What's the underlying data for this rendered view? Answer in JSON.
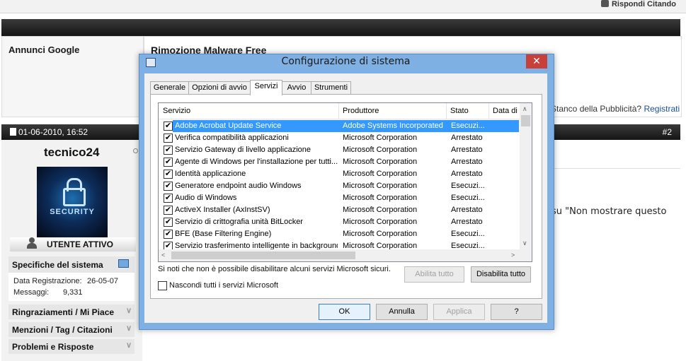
{
  "forum": {
    "reply_quote": "Rispondi Citando",
    "ad_label": "Annunci Google",
    "ad_title": "Rimozione Malware Free",
    "ad_tail_text": "Stanco della Pubblicità?",
    "ad_tail_link": "Registrati",
    "post_date": "01-06-2010, 16:52",
    "post_number": "#2",
    "username": "tecnico24",
    "avatar_text": "SECURITY",
    "user_status": "UTENTE ATTIVO",
    "system_specs": "Specifiche del sistema",
    "reg_label": "Data Registrazione:",
    "reg_value": "26-05-07",
    "msgs_label": "Messaggi:",
    "msgs_value": "9,331",
    "thanks": "Ringraziamenti / Mi Piace",
    "mentions": "Menzioni / Tag / Citazioni",
    "problems": "Problemi e Risposte",
    "post_text": "su \"Non mostrare questo"
  },
  "dialog": {
    "title": "Configurazione di sistema",
    "close": "✕",
    "tabs": [
      "Generale",
      "Opzioni di avvio",
      "Servizi",
      "Avvio",
      "Strumenti"
    ],
    "selected_tab": "Servizi",
    "columns": [
      "Servizio",
      "Produttore",
      "Stato",
      "Data di"
    ],
    "rows": [
      {
        "name": "Adobe Acrobat Update Service",
        "maker": "Adobe Systems Incorporated",
        "state": "Esecuzi...",
        "checked": true,
        "selected": true
      },
      {
        "name": "Verifica compatibilità applicazioni",
        "maker": "Microsoft Corporation",
        "state": "Arrestato",
        "checked": true
      },
      {
        "name": "Servizio Gateway di livello applicazione",
        "maker": "Microsoft Corporation",
        "state": "Arrestato",
        "checked": true
      },
      {
        "name": "Agente di Windows per l'installazione per tutti...",
        "maker": "Microsoft Corporation",
        "state": "Arrestato",
        "checked": true
      },
      {
        "name": "Identità applicazione",
        "maker": "Microsoft Corporation",
        "state": "Arrestato",
        "checked": true
      },
      {
        "name": "Generatore endpoint audio Windows",
        "maker": "Microsoft Corporation",
        "state": "Esecuzi...",
        "checked": true
      },
      {
        "name": "Audio di Windows",
        "maker": "Microsoft Corporation",
        "state": "Esecuzi...",
        "checked": true
      },
      {
        "name": "ActiveX Installer (AxInstSV)",
        "maker": "Microsoft Corporation",
        "state": "Arrestato",
        "checked": true
      },
      {
        "name": "Servizio di crittografia unità BitLocker",
        "maker": "Microsoft Corporation",
        "state": "Arrestato",
        "checked": true
      },
      {
        "name": "BFE (Base Filtering Engine)",
        "maker": "Microsoft Corporation",
        "state": "Esecuzi...",
        "checked": true
      },
      {
        "name": "Servizio trasferimento intelligente in background",
        "maker": "Microsoft Corporation",
        "state": "Esecuzi...",
        "checked": true
      }
    ],
    "note": "Si noti che non è possibile disabilitare alcuni servizi Microsoft sicuri.",
    "enable_all": "Abilita tutto",
    "disable_all": "Disabilita tutto",
    "hide_ms": "Nascondi tutti i servizi Microsoft",
    "ok": "OK",
    "cancel": "Annulla",
    "apply": "Applica",
    "help": "?"
  },
  "colors": {
    "selection": "#3399ff",
    "close": "#c7403a",
    "frame": "#7fb0e4",
    "dark_bar": "#1f1f1f"
  },
  "icons": [
    "quote-icon",
    "document-icon",
    "user-icon",
    "monitor-icon",
    "chevron-down-icon",
    "msconfig-icon",
    "close-icon",
    "checkbox-icon"
  ]
}
